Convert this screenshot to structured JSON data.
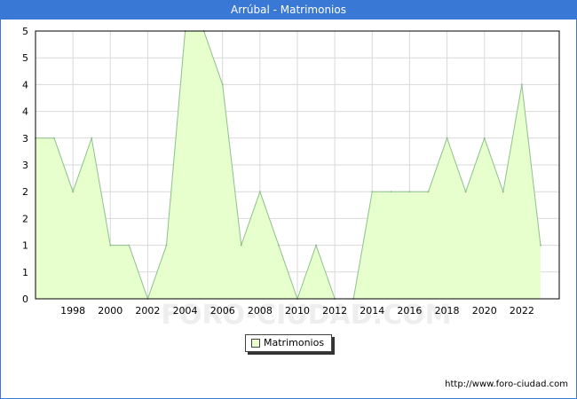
{
  "header": {
    "title": "Arrúbal - Matrimonios"
  },
  "legend": {
    "label": "Matrimonios"
  },
  "footer": {
    "source": "http://www.foro-ciudad.com"
  },
  "watermark": "FORO-CIUDAD.COM",
  "colors": {
    "title_bar": "#3a78d6",
    "area_fill": "#e6ffcc",
    "area_line": "#8fbf8f",
    "grid": "#d9d9d9"
  },
  "chart_data": {
    "type": "area",
    "title": "Arrúbal - Matrimonios",
    "xlabel": "",
    "ylabel": "",
    "x": [
      1996,
      1997,
      1998,
      1999,
      2000,
      2001,
      2002,
      2003,
      2004,
      2005,
      2006,
      2007,
      2008,
      2009,
      2010,
      2011,
      2012,
      2013,
      2014,
      2015,
      2016,
      2017,
      2018,
      2019,
      2020,
      2021,
      2022,
      2023
    ],
    "series": [
      {
        "name": "Matrimonios",
        "values": [
          3,
          3,
          2,
          3,
          1,
          1,
          0,
          1,
          5,
          5,
          4,
          1,
          2,
          1,
          0,
          1,
          0,
          0,
          2,
          2,
          2,
          2,
          3,
          2,
          3,
          2,
          4,
          1
        ]
      }
    ],
    "xticks": [
      1998,
      2000,
      2002,
      2004,
      2006,
      2008,
      2010,
      2012,
      2014,
      2016,
      2018,
      2020,
      2022
    ],
    "yticks": [
      0,
      1,
      1,
      2,
      2,
      3,
      3,
      4,
      4,
      5,
      5
    ],
    "xlim": [
      1996,
      2024
    ],
    "ylim": [
      0,
      5
    ],
    "grid": true,
    "legend_position": "bottom-center"
  }
}
